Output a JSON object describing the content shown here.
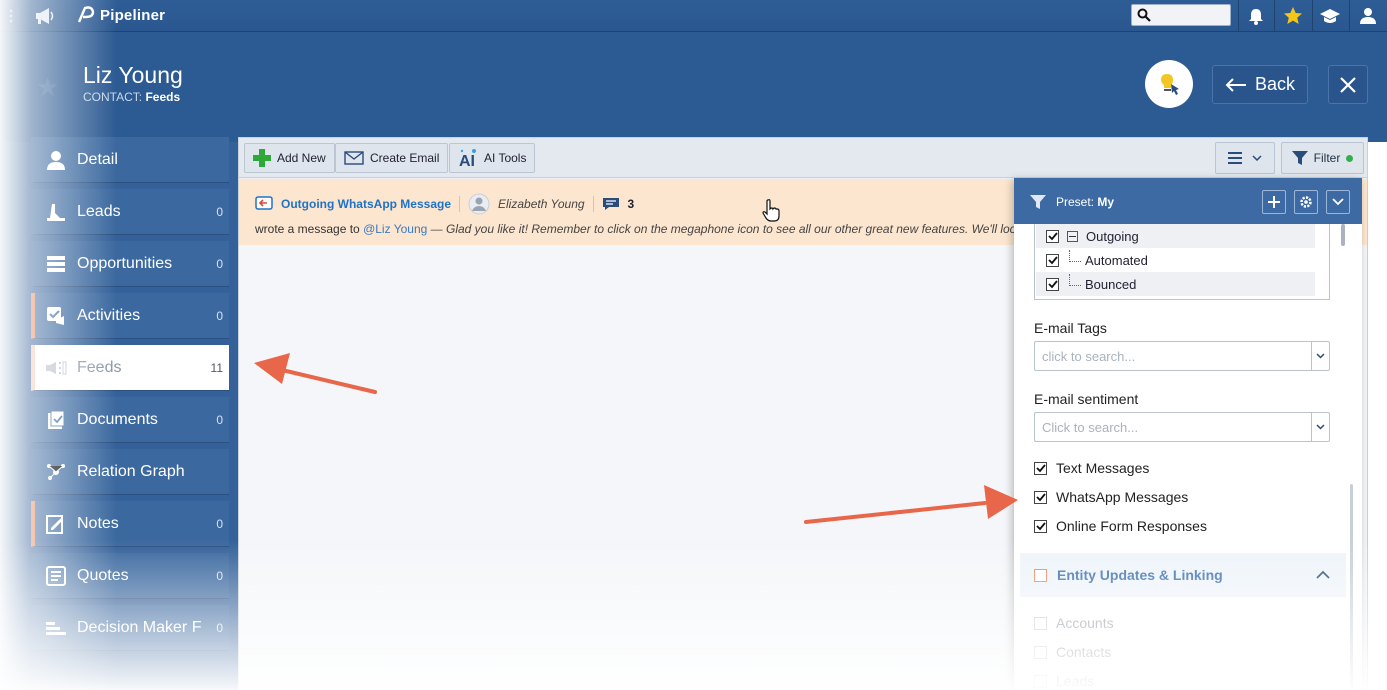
{
  "topbar": {
    "brand": "Pipeliner",
    "search_placeholder": ""
  },
  "header": {
    "title": "Liz Young",
    "subtitle_prefix": "CONTACT:",
    "subtitle_value": "Feeds",
    "back_label": "Back"
  },
  "sidebar": {
    "items": [
      {
        "label": "Detail",
        "count": "",
        "icon": "person-icon"
      },
      {
        "label": "Leads",
        "count": "0",
        "icon": "leads-icon"
      },
      {
        "label": "Opportunities",
        "count": "0",
        "icon": "opportunities-icon"
      },
      {
        "label": "Activities",
        "count": "0",
        "icon": "activities-icon"
      },
      {
        "label": "Feeds",
        "count": "11",
        "icon": "feeds-icon"
      },
      {
        "label": "Documents",
        "count": "0",
        "icon": "documents-icon"
      },
      {
        "label": "Relation Graph",
        "count": "",
        "icon": "relation-graph-icon"
      },
      {
        "label": "Notes",
        "count": "0",
        "icon": "notes-icon"
      },
      {
        "label": "Quotes",
        "count": "0",
        "icon": "quotes-icon"
      },
      {
        "label": "Decision Maker F...",
        "count": "0",
        "icon": "decision-maker-icon"
      }
    ]
  },
  "toolbar": {
    "add_new": "Add New",
    "create_email": "Create Email",
    "ai_tools": "AI Tools",
    "filter": "Filter"
  },
  "feed": {
    "type": "Outgoing WhatsApp Message",
    "author": "Elizabeth Young",
    "comment_count": "3",
    "text_prefix": "wrote a message to",
    "mention": "@Liz Young",
    "text_body": "— Glad you like it! Remember to click on the megaphone icon to see all our other great new features. We'll look fo"
  },
  "filter_panel": {
    "preset_label": "Preset:",
    "preset_value": "My",
    "tree": [
      {
        "label": "Outgoing",
        "checked": true
      },
      {
        "label": "Automated",
        "checked": true
      },
      {
        "label": "Bounced",
        "checked": true
      }
    ],
    "email_tags_label": "E-mail Tags",
    "email_tags_placeholder": "click to search...",
    "email_sentiment_label": "E-mail sentiment",
    "email_sentiment_placeholder": "Click to search...",
    "checks": [
      {
        "label": "Text Messages",
        "checked": true
      },
      {
        "label": "WhatsApp Messages",
        "checked": true
      },
      {
        "label": "Online Form Responses",
        "checked": true
      }
    ],
    "section_title": "Entity Updates & Linking",
    "section_items": [
      {
        "label": "Accounts",
        "checked": false
      },
      {
        "label": "Contacts",
        "checked": false
      },
      {
        "label": "Leads",
        "checked": false
      }
    ]
  },
  "colors": {
    "brand_blue": "#2c5a92",
    "accent_orange": "#e8895a",
    "feed_highlight": "#fde6cf",
    "annotation_arrow": "#e8674a"
  }
}
